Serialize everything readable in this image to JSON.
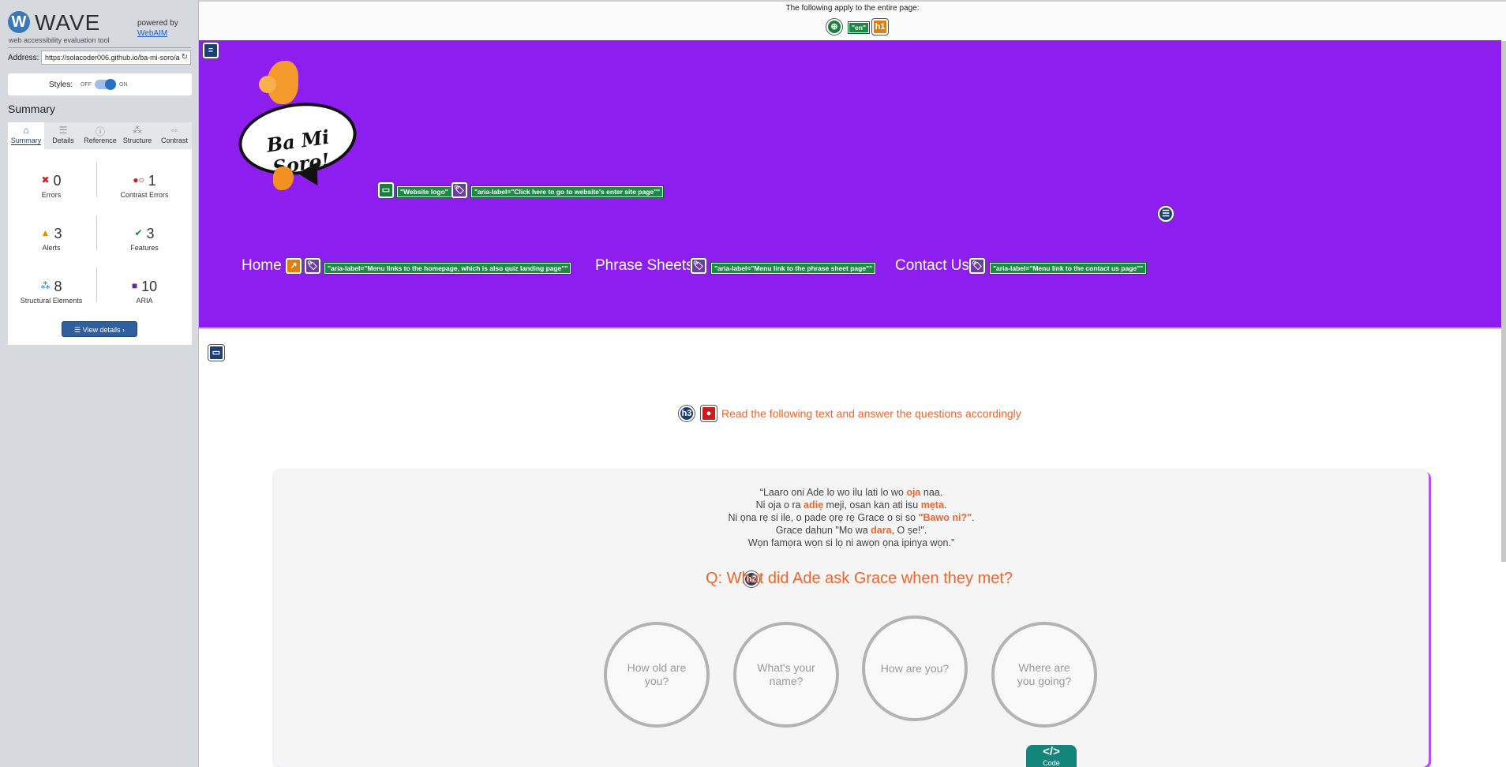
{
  "wave": {
    "logo_letter": "W",
    "title": "WAVE",
    "subtitle": "web accessibility evaluation tool",
    "powered_by": "powered by",
    "webaim": "WebAIM",
    "address_label": "Address:",
    "address_value": "https://solacoder006.github.io/ba-mi-soro/a",
    "styles_label": "Styles:",
    "styles_off": "OFF",
    "styles_on": "ON",
    "summary_heading": "Summary",
    "tabs": [
      {
        "label": "Summary",
        "icon": "home-icon"
      },
      {
        "label": "Details",
        "icon": "list-icon"
      },
      {
        "label": "Reference",
        "icon": "info-icon"
      },
      {
        "label": "Structure",
        "icon": "structure-icon"
      },
      {
        "label": "Contrast",
        "icon": "contrast-icon"
      }
    ],
    "stats": {
      "errors": {
        "count": "0",
        "label": "Errors"
      },
      "contrast": {
        "count": "1",
        "label": "Contrast Errors"
      },
      "alerts": {
        "count": "3",
        "label": "Alerts"
      },
      "features": {
        "count": "3",
        "label": "Features"
      },
      "structural": {
        "count": "8",
        "label": "Structural Elements"
      },
      "aria": {
        "count": "10",
        "label": "ARIA"
      }
    },
    "view_details": "View details ›"
  },
  "page": {
    "notice": "The following apply to the entire page:",
    "lang_tag": "\"en\"",
    "h1_icon": "h1",
    "logo_text": "Ba Mi Soro!",
    "logo_alt_tag": "\"Website logo\"",
    "logo_aria_tag": "\"aria-label=\"Click here to go to website's enter site page\"\"",
    "nav": [
      {
        "label": "Home",
        "aria": "\"aria-label=\"Menu links to the homepage, which is also quiz landing page\"\""
      },
      {
        "label": "Phrase Sheets",
        "aria": "\"aria-label=\"Menu link to the phrase sheet page\"\""
      },
      {
        "label": "Contact Us",
        "aria": "\"aria-label=\"Menu link to the contact us page\"\""
      }
    ],
    "h3_icon": "h3",
    "h3_text": "Read the following text and answer the questions accordingly",
    "passage": {
      "l1a": "“Laaro oni Ade lo wo ilu lati lo wo ",
      "l1b": "oja",
      "l1c": " naa.",
      "l2a": "Ni oja o ra ",
      "l2b": "adiẹ",
      "l2c": " meji, osan kan ati isu ",
      "l2d": "mẹta",
      "l2e": ".",
      "l3a": "Ni ọna rẹ si ile, o pade ọrẹ rẹ Grace o si so ",
      "l3b": "\"Bawo ni?\"",
      "l3c": ".",
      "l4a": "Grace dahun \"Mo wa ",
      "l4b": "dara",
      "l4c": ", O ṣe!\".",
      "l5": "Wọn famọra wọn si lọ ni awọn ọna ipinya wọn.”"
    },
    "h2_icon": "h2",
    "question": "Q: What did Ade ask Grace when they met?",
    "answers": [
      "How old are you?",
      "What's your name?",
      "How are you?",
      "Where are you going?"
    ],
    "code_icon": "</>",
    "code_label": "Code"
  },
  "colors": {
    "header_bg": "#8e1ef0",
    "accent": "#f0642c",
    "wave_blue": "#2f5f9e"
  }
}
